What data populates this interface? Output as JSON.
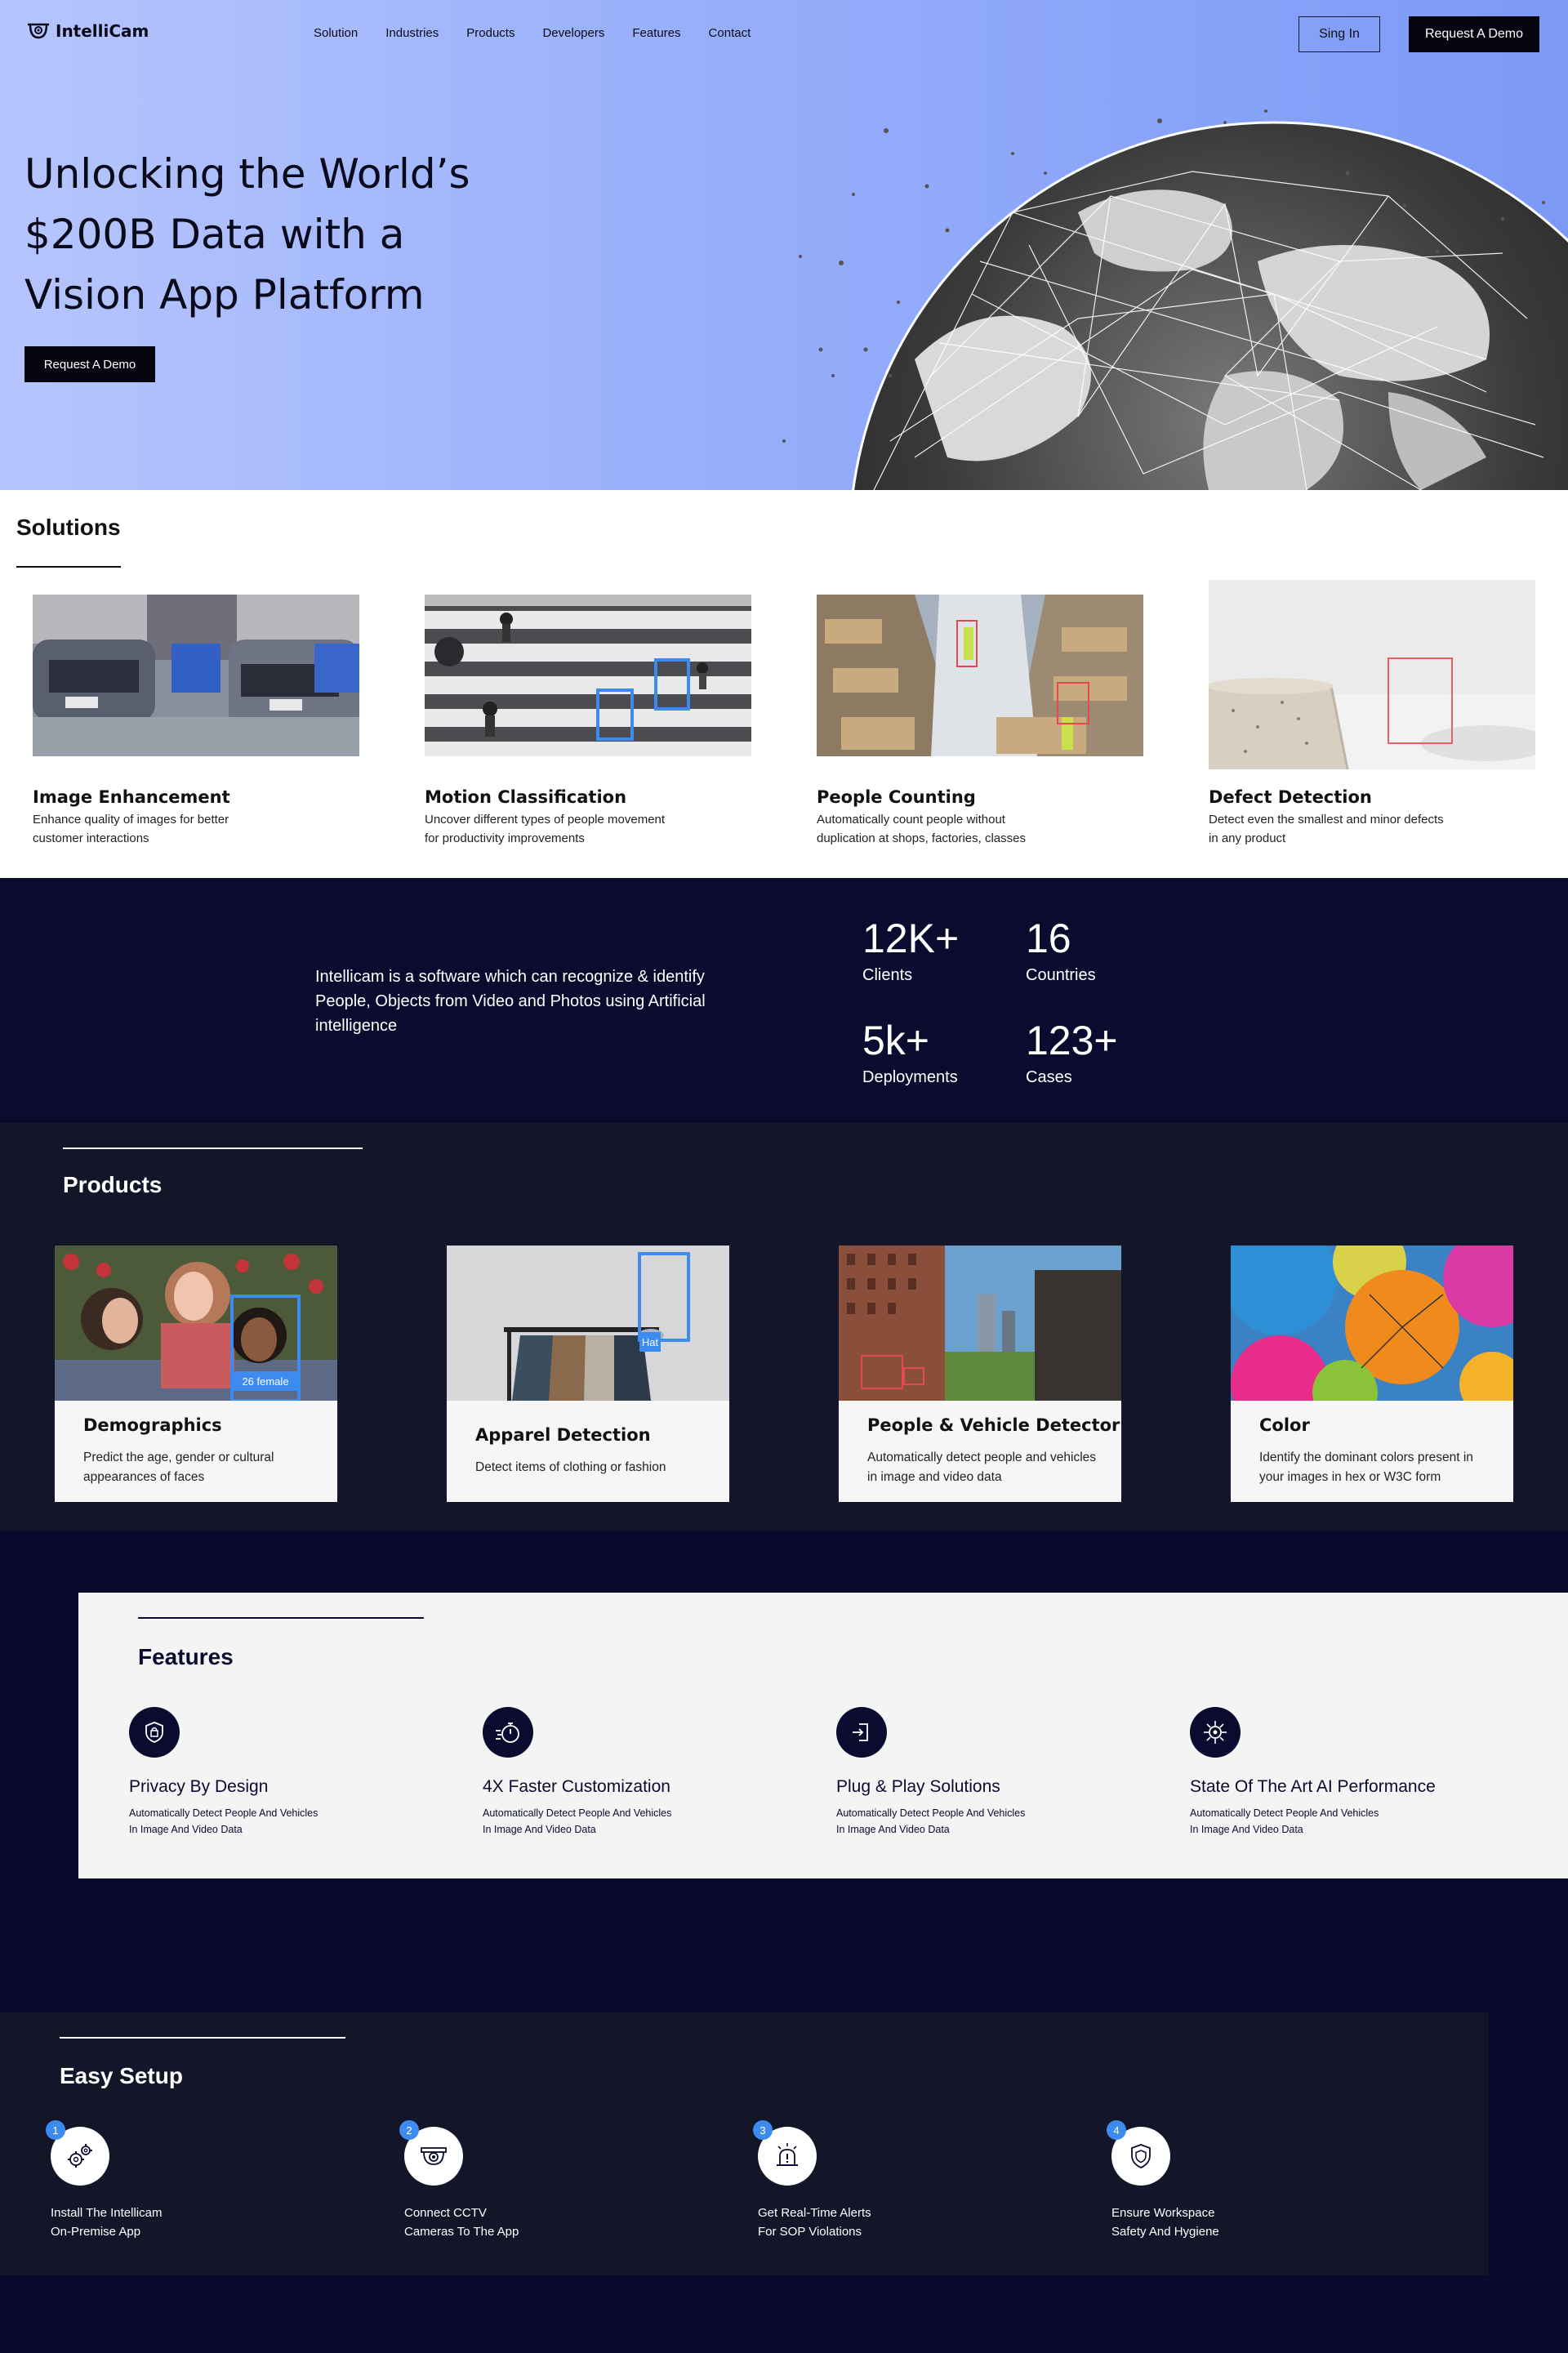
{
  "header": {
    "logo_text": "IntelliCam",
    "nav": [
      "Solution",
      "Industries",
      "Products",
      "Developers",
      "Features",
      "Contact"
    ],
    "signin_label": "Sing In",
    "demo_label": "Request A Demo"
  },
  "hero": {
    "title_lines": [
      "Unlocking the World’s",
      "$200B Data with a",
      "Vision App Platform"
    ],
    "cta_label": "Request A Demo"
  },
  "solutions": {
    "title": "Solutions",
    "items": [
      {
        "name": "Image Enhancement",
        "desc": "Enhance quality of images for better customer interactions"
      },
      {
        "name": "Motion Classification",
        "desc": "Uncover different types of people movement for productivity improvements"
      },
      {
        "name": "People Counting",
        "desc": "Automatically count people without duplication at shops, factories, classes"
      },
      {
        "name": "Defect Detection",
        "desc": "Detect even the smallest and minor defects in any product"
      }
    ]
  },
  "stats": {
    "about": "Intellicam is a software which can recognize & identify People, Objects from Video and Photos using Artificial intelligence",
    "items": [
      {
        "num": "12K+",
        "label": "Clients"
      },
      {
        "num": "16",
        "label": "Countries"
      },
      {
        "num": "5k+",
        "label": "Deployments"
      },
      {
        "num": "123+",
        "label": "Cases"
      }
    ]
  },
  "products": {
    "title": "Products",
    "items": [
      {
        "name": "Demographics",
        "desc": "Predict the age, gender or cultural appearances of faces",
        "tag": "26 female"
      },
      {
        "name": "Apparel Detection",
        "desc": "Detect items of clothing or fashion",
        "tag": "Hat"
      },
      {
        "name": "People & Vehicle Detector",
        "desc": "Automatically detect people and vehicles in image and video data",
        "tag": ""
      },
      {
        "name": "Color",
        "desc": "Identify the dominant colors present in your images in hex or W3C form",
        "tag": ""
      }
    ]
  },
  "features": {
    "title": "Features",
    "items": [
      {
        "name": "Privacy By Design",
        "desc": "Automatically Detect People And Vehicles In Image And Video Data",
        "icon": "shield-icon"
      },
      {
        "name": "4X Faster Customization",
        "desc": "Automatically Detect People And Vehicles In Image And Video Data",
        "icon": "stopwatch-icon"
      },
      {
        "name": "Plug & Play Solutions",
        "desc": "Automatically Detect People And Vehicles In Image And Video Data",
        "icon": "plug-in-icon"
      },
      {
        "name": "State Of The Art AI Performance",
        "desc": "Automatically Detect People And Vehicles In Image And Video Data",
        "icon": "ai-chip-icon"
      }
    ]
  },
  "setup": {
    "title": "Easy Setup",
    "steps": [
      {
        "num": "1",
        "text1": "Install The Intellicam",
        "text2": "On-Premise App",
        "icon": "gears-icon"
      },
      {
        "num": "2",
        "text1": "Connect CCTV",
        "text2": "Cameras To The App",
        "icon": "cctv-camera-icon"
      },
      {
        "num": "3",
        "text1": "Get Real-Time Alerts",
        "text2": "For SOP Violations",
        "icon": "alarm-icon"
      },
      {
        "num": "4",
        "text1": "Ensure Workspace",
        "text2": "Safety And Hygiene",
        "icon": "shield-icon"
      }
    ]
  }
}
